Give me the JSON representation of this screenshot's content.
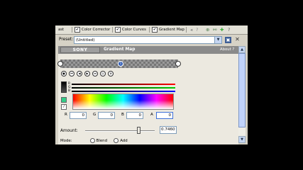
{
  "tabs": {
    "first_partial": "ast",
    "items": [
      {
        "label": "Color Corrector",
        "checked": "✔"
      },
      {
        "label": "Color Curves",
        "checked": "✔"
      },
      {
        "label": "Gradient Map",
        "checked": "✔"
      }
    ],
    "icons": [
      "add-icon",
      "remove-icon",
      "help-icon"
    ]
  },
  "preset": {
    "label": "Preset:",
    "value": "(Untitled)"
  },
  "plugin": {
    "vendor": "SONY",
    "name": "Gradient Map",
    "about": "About ?"
  },
  "gradient": {
    "marker_position": 0.5
  },
  "channels": {
    "r": "R",
    "g": "G",
    "b": "B"
  },
  "color_values": {
    "r_label": "R",
    "r_value": "0",
    "g_label": "G",
    "g_value": "0",
    "b_label": "B",
    "b_value": "0",
    "a_label": "A",
    "a_value": "0"
  },
  "amount": {
    "label": "Amount:",
    "value": "0.7460",
    "fraction": 0.746
  },
  "mode": {
    "label": "Mode:",
    "options": [
      "Blend",
      "Add"
    ]
  },
  "colors": {
    "accent": "#2f5bb5",
    "window_bg": "#d6d2c6",
    "header_bg": "#8a8a8a"
  }
}
